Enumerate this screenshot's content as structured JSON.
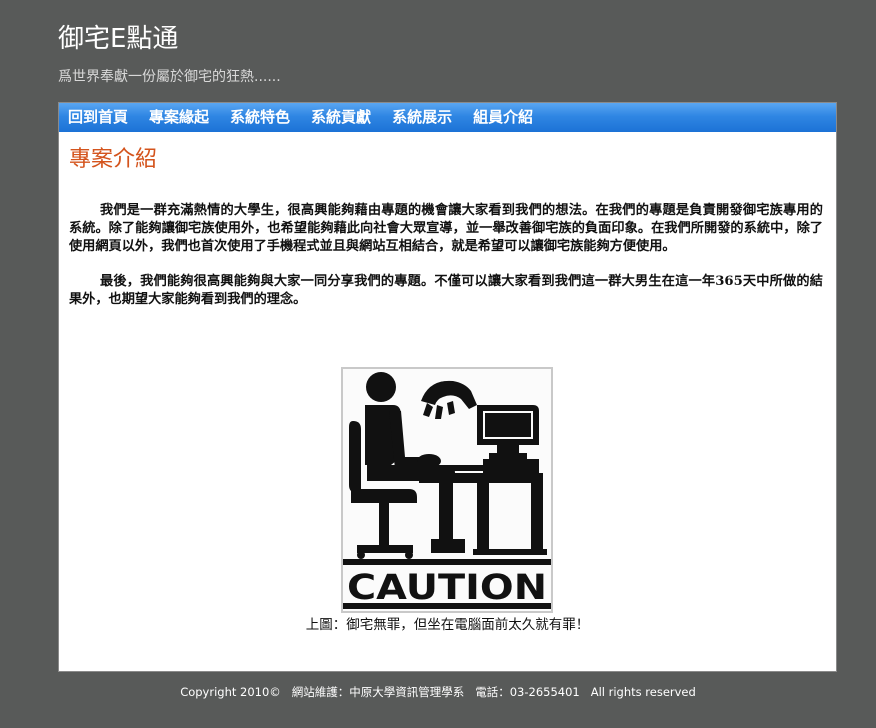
{
  "site": {
    "title": "御宅E點通",
    "subtitle": "爲世界奉獻一份屬於御宅的狂熱......"
  },
  "nav": {
    "items": [
      {
        "id": "home",
        "label": "回到首頁"
      },
      {
        "id": "origin",
        "label": "專案緣起"
      },
      {
        "id": "features",
        "label": "系統特色"
      },
      {
        "id": "contribution",
        "label": "系統貢獻"
      },
      {
        "id": "demo",
        "label": "系統展示"
      },
      {
        "id": "members",
        "label": "組員介紹"
      }
    ]
  },
  "main": {
    "heading": "專案介紹",
    "paragraphs": [
      "我們是一群充滿熱情的大學生，很高興能夠藉由專題的機會讓大家看到我們的想法。在我們的專題是負責開發御宅族專用的系統。除了能夠讓御宅族使用外，也希望能夠藉此向社會大眾宣導，並一舉改善御宅族的負面印象。在我們所開發的系統中，除了使用網頁以外，我們也首次使用了手機程式並且與網站互相結合，就是希望可以讓御宅族能夠方便使用。",
      "最後，我們能夠很高興能夠與大家一同分享我們的專題。不僅可以讓大家看到我們這一群大男生在這一年365天中所做的結果外，也期望大家能夠看到我們的理念。"
    ],
    "figure": {
      "sign_text": "CAUTION",
      "caption": "上圖：御宅無罪，但坐在電腦面前太久就有罪！"
    }
  },
  "footer": {
    "text": "Copyright 2010©   網站維護：中原大學資訊管理學系   電話：03-2655401   All rights reserved"
  }
}
